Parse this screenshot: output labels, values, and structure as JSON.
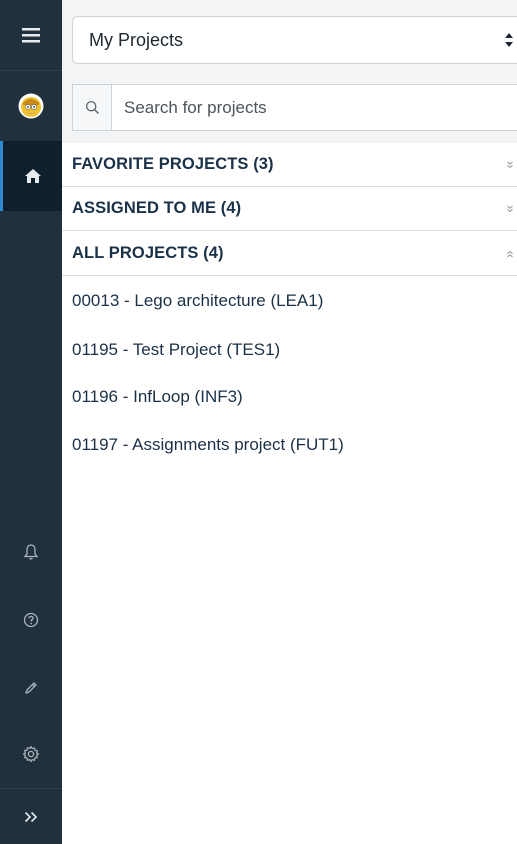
{
  "sidebar": {
    "items": [
      {
        "icon": "menu-icon"
      },
      {
        "icon": "avatar"
      },
      {
        "icon": "home-icon",
        "active": true
      },
      {
        "icon": "bell-icon"
      },
      {
        "icon": "help-icon"
      },
      {
        "icon": "pencil-icon"
      },
      {
        "icon": "gear-icon"
      },
      {
        "icon": "expand-icon"
      }
    ]
  },
  "header": {
    "selector_value": "My Projects"
  },
  "search": {
    "placeholder": "Search for projects",
    "value": ""
  },
  "sections": [
    {
      "label": "FAVORITE PROJECTS (3)",
      "expanded": false
    },
    {
      "label": "ASSIGNED TO ME (4)",
      "expanded": false
    },
    {
      "label": "ALL PROJECTS (4)",
      "expanded": true
    }
  ],
  "projects": [
    {
      "label": "00013 - Lego architecture (LEA1)"
    },
    {
      "label": "01195 - Test Project (TES1)"
    },
    {
      "label": "01196 - InfLoop (INF3)"
    },
    {
      "label": "01197 - Assignments project (FUT1)"
    }
  ],
  "colors": {
    "rail_bg": "#21303d",
    "active_accent": "#2f8bcd",
    "text_dark": "#1a3148"
  }
}
